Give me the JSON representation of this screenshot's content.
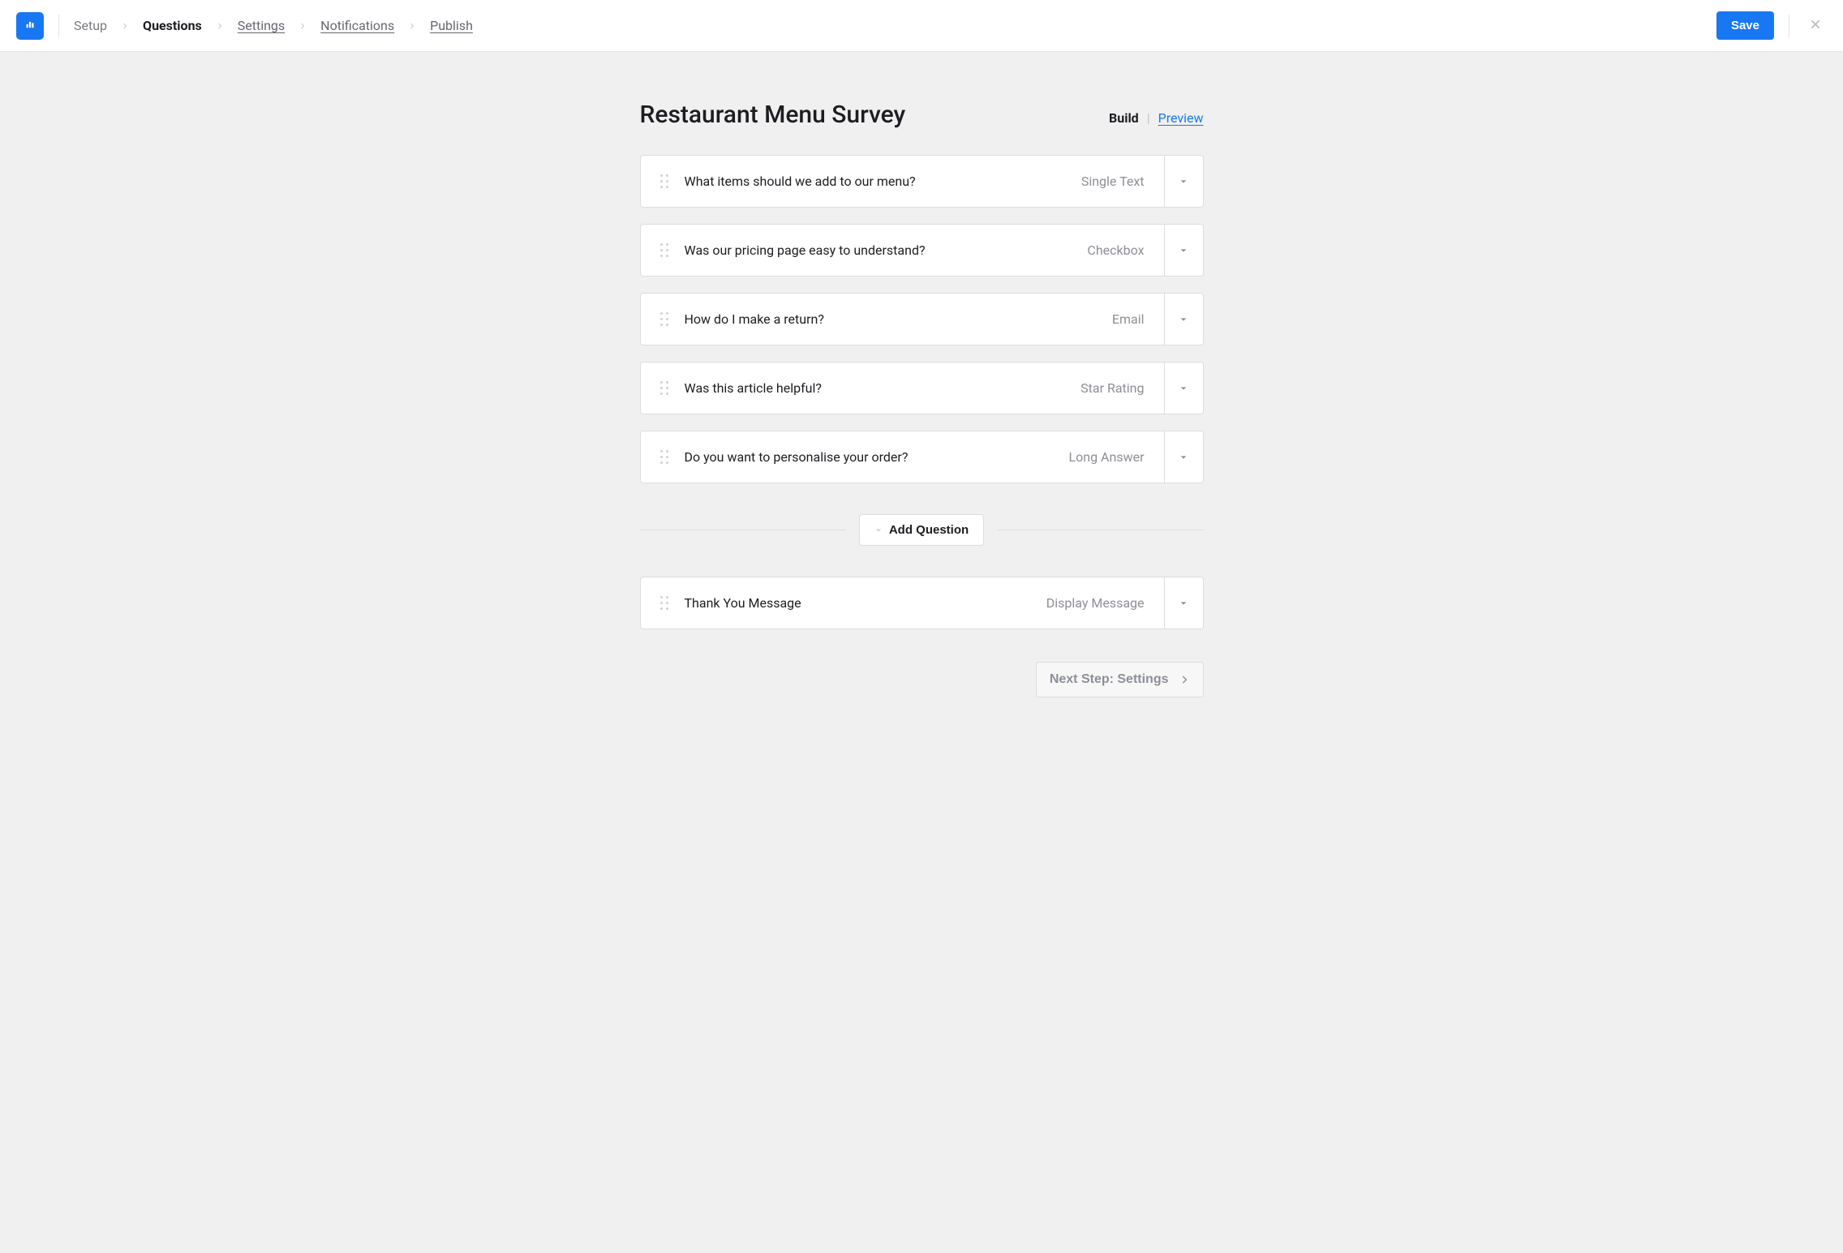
{
  "topbar": {
    "breadcrumb": {
      "setup": "Setup",
      "questions": "Questions",
      "settings": "Settings",
      "notifications": "Notifications",
      "publish": "Publish"
    },
    "save_label": "Save"
  },
  "header": {
    "title": "Restaurant Menu Survey",
    "build_label": "Build",
    "preview_label": "Preview"
  },
  "questions": [
    {
      "text": "What items should we add to our menu?",
      "type": "Single Text"
    },
    {
      "text": "Was our pricing page easy to understand?",
      "type": "Checkbox"
    },
    {
      "text": "How do I make a return?",
      "type": "Email"
    },
    {
      "text": "Was this article helpful?",
      "type": "Star Rating"
    },
    {
      "text": "Do you want to personalise your order?",
      "type": "Long Answer"
    }
  ],
  "add_question_label": "Add Question",
  "thank_you": {
    "text": "Thank You Message",
    "type": "Display Message"
  },
  "next_step_label": "Next Step: Settings"
}
